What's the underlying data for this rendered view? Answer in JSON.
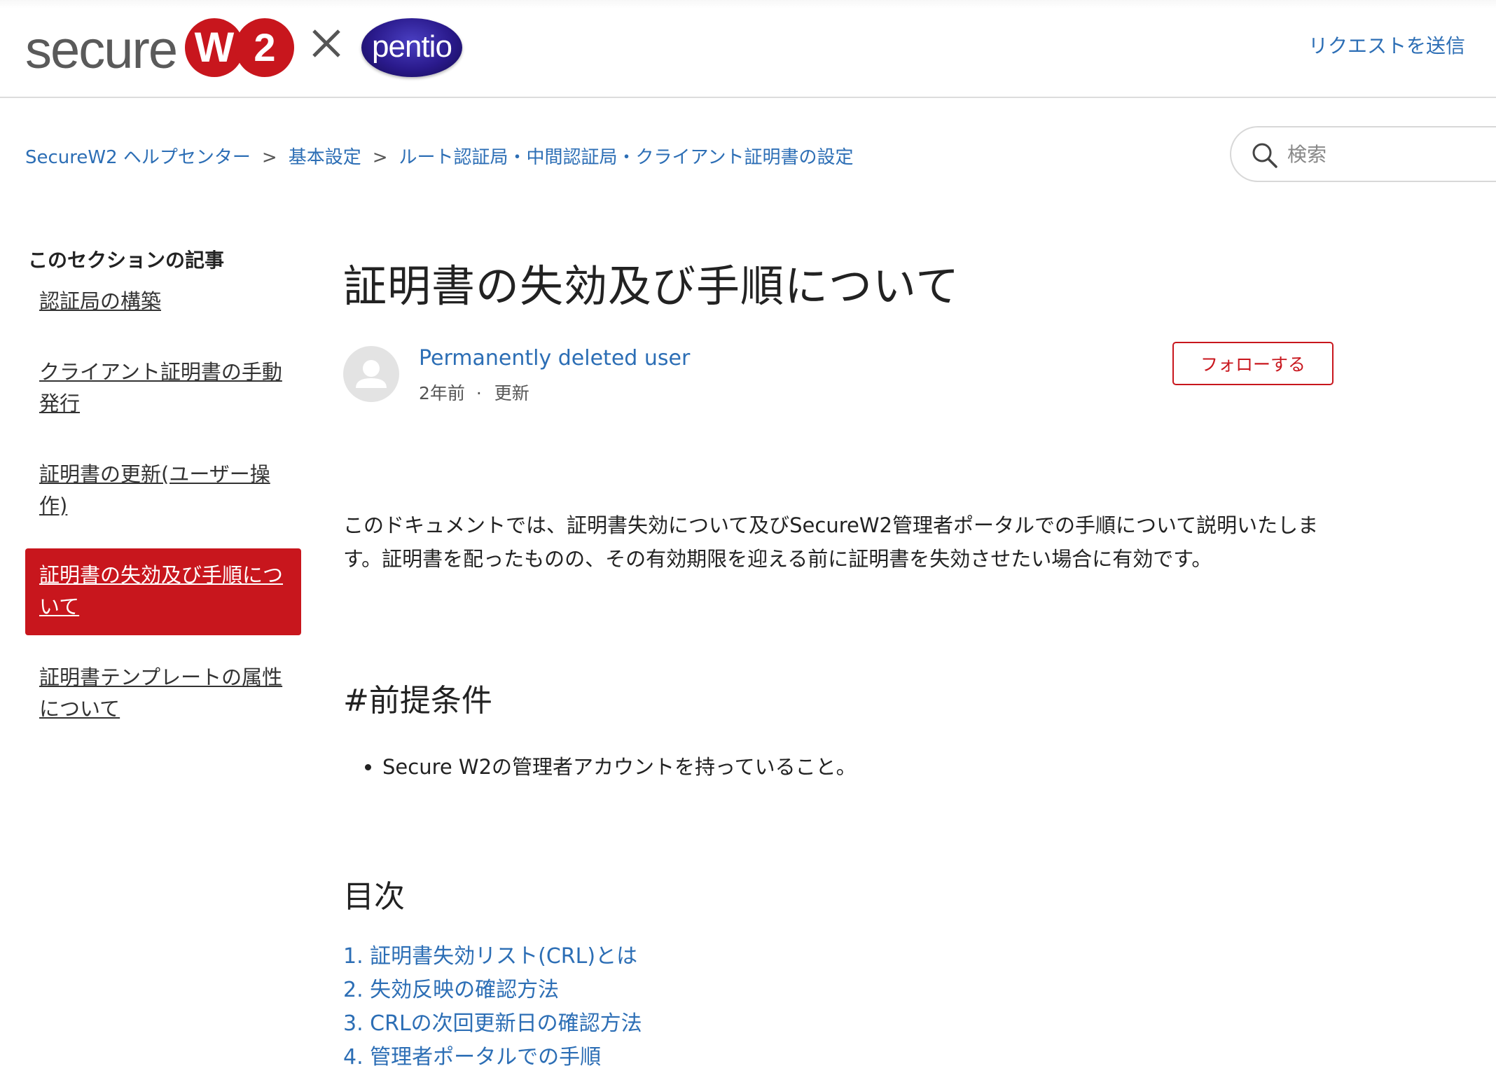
{
  "header": {
    "logo_secure": "secure",
    "logo_w": "W",
    "logo_2": "2",
    "partner_logo": "pentio",
    "request_link": "リクエストを送信"
  },
  "breadcrumb": {
    "items": [
      "SecureW2 ヘルプセンター",
      "基本設定",
      "ルート認証局・中間認証局・クライアント証明書の設定"
    ],
    "separator": ">"
  },
  "search": {
    "placeholder": "検索"
  },
  "sidebar": {
    "title": "このセクションの記事",
    "items": [
      {
        "label": "認証局の構築",
        "active": false
      },
      {
        "label": "クライアント証明書の手動発行",
        "active": false
      },
      {
        "label": "証明書の更新(ユーザー操作)",
        "active": false
      },
      {
        "label": "証明書の失効及び手順について",
        "active": true
      },
      {
        "label": "証明書テンプレートの属性について",
        "active": false
      }
    ]
  },
  "article": {
    "title": "証明書の失効及び手順について",
    "author": "Permanently deleted user",
    "time": "2年前",
    "dot": "·",
    "updated": "更新",
    "follow_button": "フォローする",
    "intro": "このドキュメントでは、証明書失効について及びSecureW2管理者ポータルでの手順について説明いたします。証明書を配ったものの、その有効期限を迎える前に証明書を失効させたい場合に有効です。",
    "prereq_heading": "#前提条件",
    "prereq_items": [
      "Secure W2の管理者アカウントを持っていること。"
    ],
    "toc_heading": "目次",
    "toc_items": [
      "1. 証明書失効リスト(CRL)とは",
      "2. 失効反映の確認方法",
      "3. CRLの次回更新日の確認方法",
      "4. 管理者ポータルでの手順"
    ]
  },
  "colors": {
    "brand_red": "#c8161d",
    "link_blue": "#2c6eb5",
    "pentio_purple": "#2a1a8c"
  }
}
